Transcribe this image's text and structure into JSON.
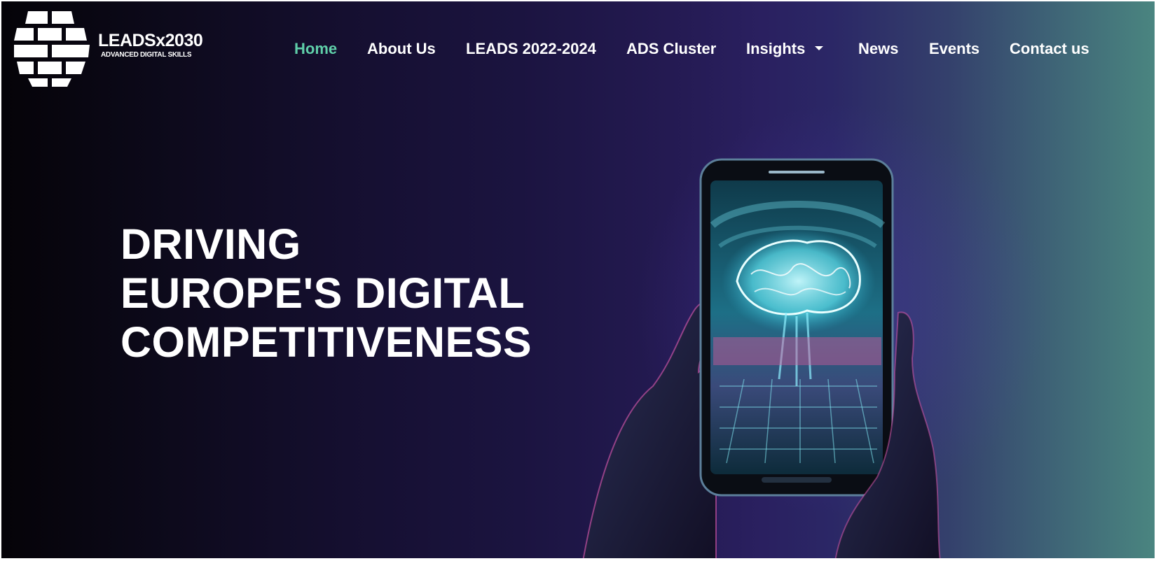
{
  "logo": {
    "title": "LEADSx2030",
    "subtitle": "ADVANCED DIGITAL SKILLS",
    "icon": "brick-logo-icon"
  },
  "nav": {
    "items": [
      {
        "label": "Home",
        "active": true
      },
      {
        "label": "About Us"
      },
      {
        "label": "LEADS 2022-2024"
      },
      {
        "label": "ADS Cluster"
      },
      {
        "label": "Insights",
        "dropdown": true,
        "icon": "caret-down-icon"
      },
      {
        "label": "News"
      },
      {
        "label": "Events"
      },
      {
        "label": "Contact us"
      }
    ]
  },
  "hero": {
    "headline_lines": [
      "DRIVING",
      "EUROPE'S DIGITAL",
      "COMPETITIVENESS"
    ],
    "image": "hands-holding-phone-with-brain-hologram"
  },
  "colors": {
    "accent": "#5fcfa9",
    "background_left": "#050308",
    "background_mid": "#2a2060",
    "background_right": "#4a8580"
  }
}
